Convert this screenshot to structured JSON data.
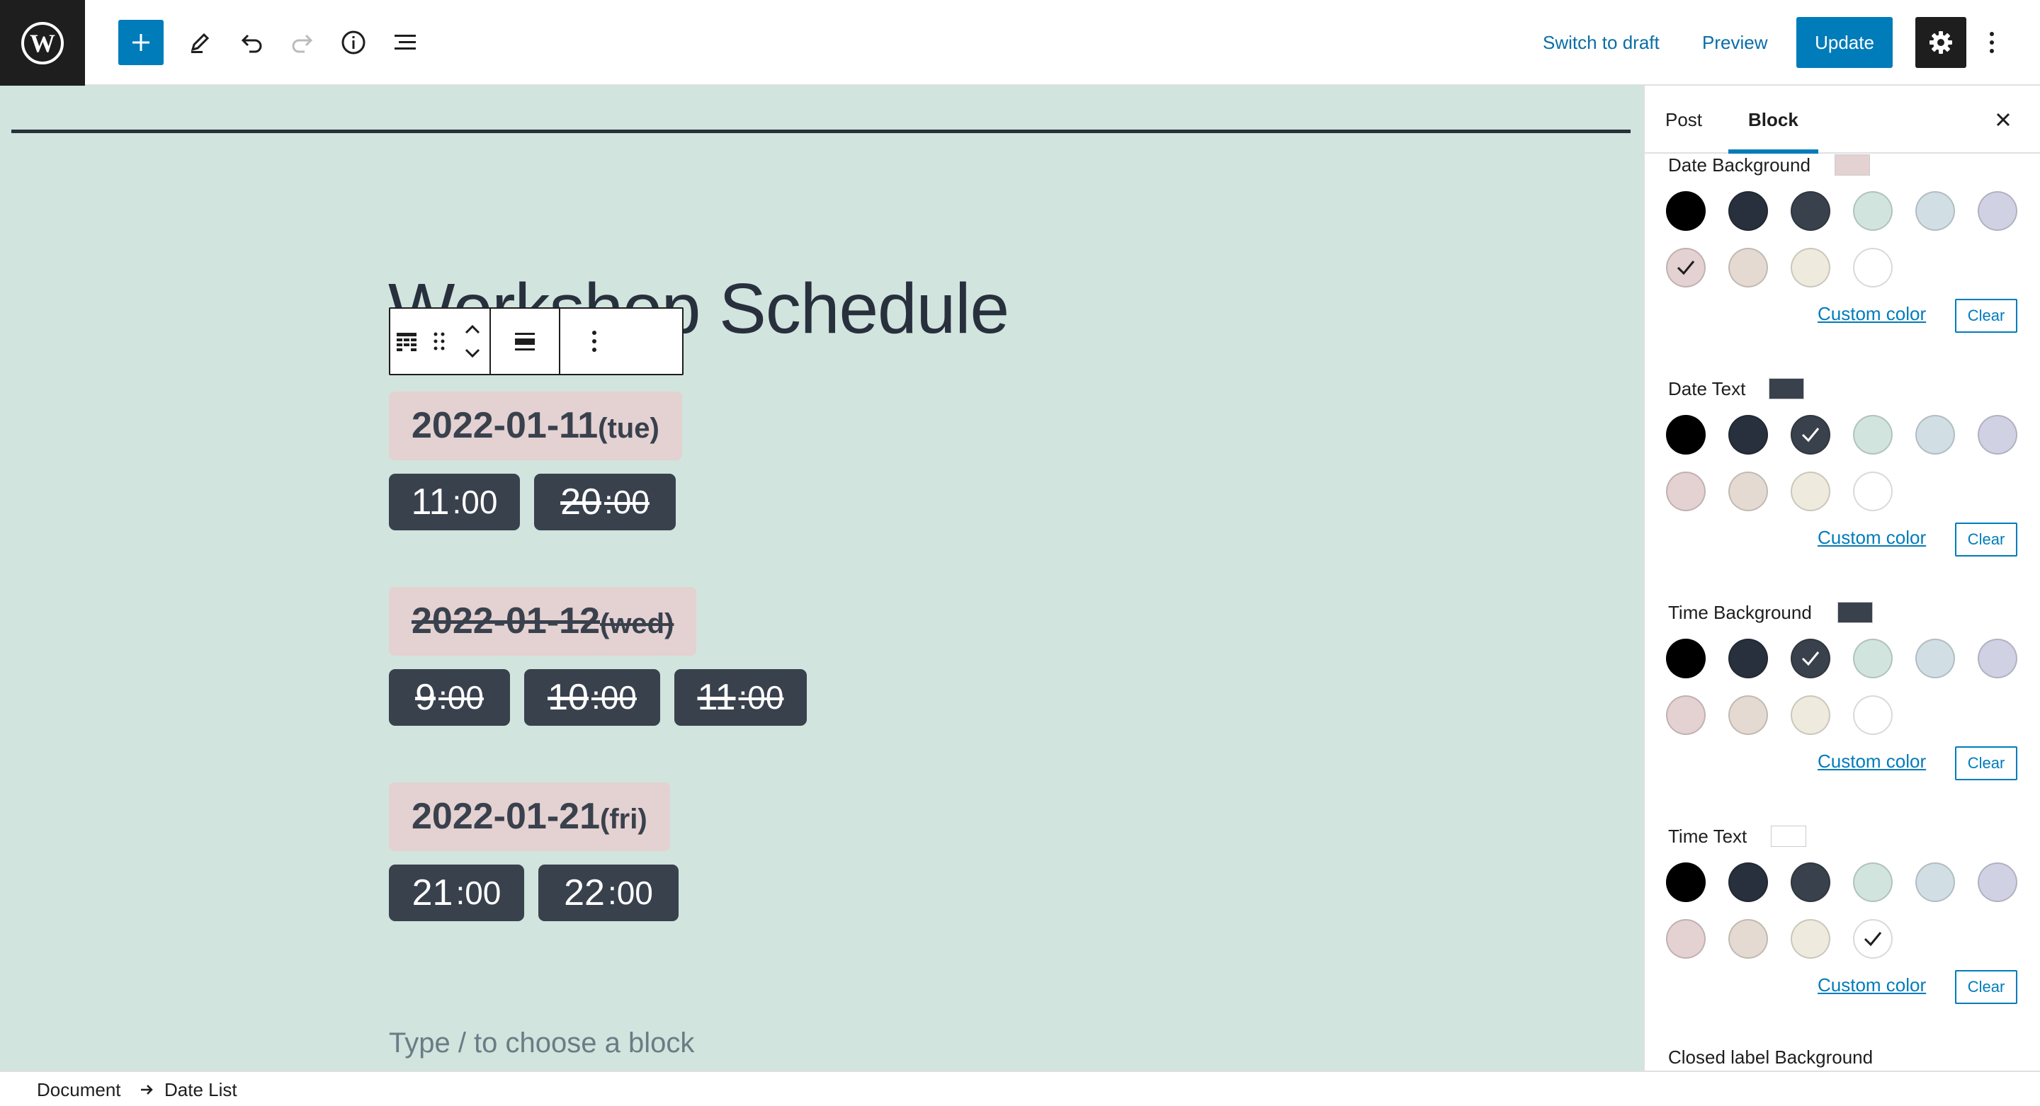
{
  "toolbar": {
    "switch_to_draft": "Switch to draft",
    "preview": "Preview",
    "update": "Update"
  },
  "canvas": {
    "title": "Workshop Schedule",
    "appender_placeholder": "Type / to choose a block",
    "dates": [
      {
        "date": "2022-01-11",
        "weekday": "(tue)",
        "closed": false,
        "times": [
          {
            "hour": "11",
            "min": ":00",
            "closed": false
          },
          {
            "hour": "20",
            "min": ":00",
            "closed": true
          }
        ]
      },
      {
        "date": "2022-01-12",
        "weekday": "(wed)",
        "closed": true,
        "times": [
          {
            "hour": "9",
            "min": ":00",
            "closed": true
          },
          {
            "hour": "10",
            "min": ":00",
            "closed": true
          },
          {
            "hour": "11",
            "min": ":00",
            "closed": true
          }
        ]
      },
      {
        "date": "2022-01-21",
        "weekday": "(fri)",
        "closed": false,
        "times": [
          {
            "hour": "21",
            "min": ":00",
            "closed": false
          },
          {
            "hour": "22",
            "min": ":00",
            "closed": false
          }
        ]
      }
    ]
  },
  "sidebar": {
    "tabs": [
      "Post",
      "Block"
    ],
    "active_tab": "Block",
    "palette": [
      "#000000",
      "#28303d",
      "#39414d",
      "#d1e4dd",
      "#d1dfe4",
      "#d1d1e4",
      "#e4d1d1",
      "#e4dad1",
      "#eeeadd",
      "#ffffff"
    ],
    "groups": [
      {
        "label": "Date Background",
        "selected_index": 6,
        "indicator": "#e4d1d1"
      },
      {
        "label": "Date Text",
        "selected_index": 2,
        "indicator": "#39414d"
      },
      {
        "label": "Time Background",
        "selected_index": 2,
        "indicator": "#39414d"
      },
      {
        "label": "Time Text",
        "selected_index": 9,
        "indicator": "#ffffff"
      }
    ],
    "custom_color_label": "Custom color",
    "clear_label": "Clear",
    "next_group_label": "Closed label Background"
  },
  "footer": {
    "breadcrumbs": [
      "Document",
      "Date List"
    ]
  },
  "colors": {
    "accent": "#007cba",
    "canvas_bg": "#d1e4dd",
    "date_bg": "#e4d1d1",
    "time_bg": "#39414d"
  }
}
